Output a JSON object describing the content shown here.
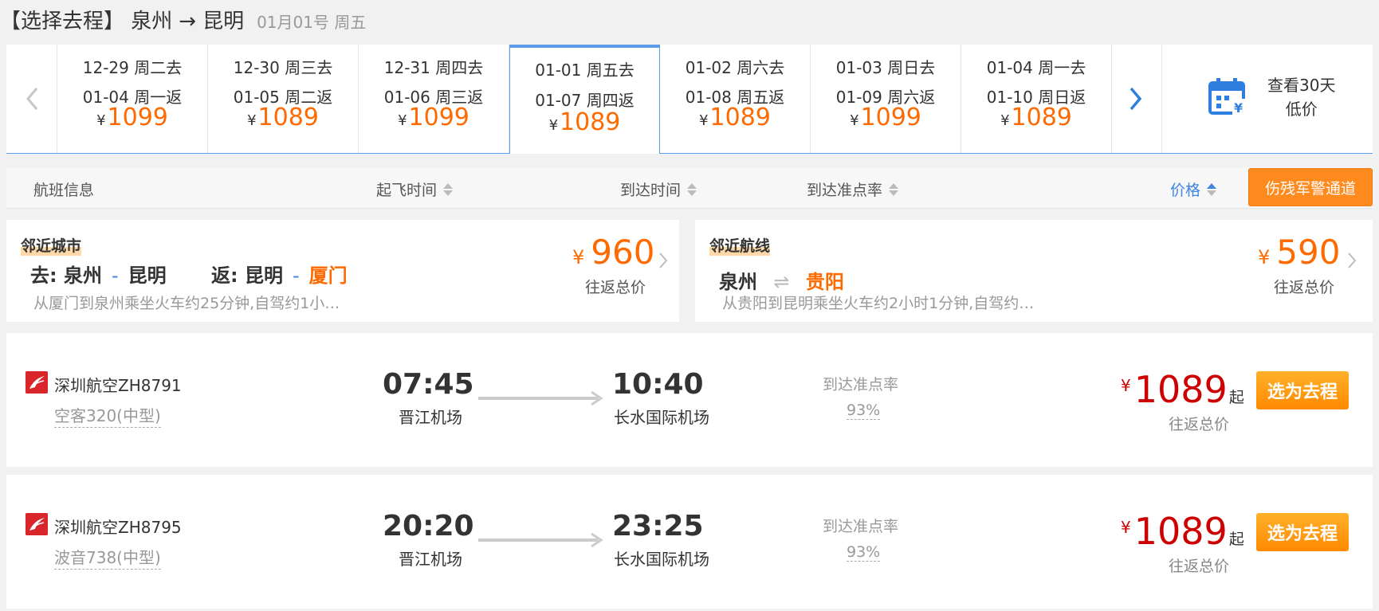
{
  "header": {
    "title": "【选择去程】 泉州",
    "arrow": "→",
    "dest": "昆明",
    "date": "01月01号 周五"
  },
  "date_strip": {
    "currency": "¥",
    "dates": [
      {
        "depart": "12-29 周二去",
        "return": "01-04 周一返",
        "price": "1099",
        "active": false
      },
      {
        "depart": "12-30 周三去",
        "return": "01-05 周二返",
        "price": "1089",
        "active": false
      },
      {
        "depart": "12-31 周四去",
        "return": "01-06 周三返",
        "price": "1099",
        "active": false
      },
      {
        "depart": "01-01 周五去",
        "return": "01-07 周四返",
        "price": "1089",
        "active": true
      },
      {
        "depart": "01-02 周六去",
        "return": "01-08 周五返",
        "price": "1089",
        "active": false
      },
      {
        "depart": "01-03 周日去",
        "return": "01-09 周六返",
        "price": "1099",
        "active": false
      },
      {
        "depart": "01-04 周一去",
        "return": "01-10 周日返",
        "price": "1089",
        "active": false
      }
    ],
    "calendar_line1": "查看30天",
    "calendar_line2": "低价"
  },
  "sort_bar": {
    "flight_info": "航班信息",
    "depart_time": "起飞时间",
    "arrive_time": "到达时间",
    "ontime": "到达准点率",
    "price": "价格",
    "special_channel": "伤残军警通道"
  },
  "nearby": [
    {
      "tag": "邻近城市",
      "go_label": "去:",
      "go_from": "泉州",
      "go_to": "昆明",
      "back_label": "返:",
      "back_from": "昆明",
      "back_to": "厦门",
      "desc": "从厦门到泉州乘坐火车约25分钟,自驾约1小…",
      "currency": "¥",
      "price": "960",
      "price_sub": "往返总价"
    },
    {
      "tag": "邻近航线",
      "from": "泉州",
      "swap": "⇌",
      "to": "贵阳",
      "desc": "从贵阳到昆明乘坐火车约2小时1分钟,自驾约…",
      "currency": "¥",
      "price": "590",
      "price_sub": "往返总价"
    }
  ],
  "flights": [
    {
      "airline": "深圳航空ZH8791",
      "plane": "空客320(中型)",
      "dep_time": "07:45",
      "dep_airport": "晋江机场",
      "arr_time": "10:40",
      "arr_airport": "长水国际机场",
      "ontime_label": "到达准点率",
      "ontime": "93%",
      "currency": "¥",
      "price": "1089",
      "qi": "起",
      "price_sub": "往返总价",
      "select": "选为去程"
    },
    {
      "airline": "深圳航空ZH8795",
      "plane": "波音738(中型)",
      "dep_time": "20:20",
      "dep_airport": "晋江机场",
      "arr_time": "23:25",
      "arr_airport": "长水国际机场",
      "ontime_label": "到达准点率",
      "ontime": "93%",
      "currency": "¥",
      "price": "1089",
      "qi": "起",
      "price_sub": "往返总价",
      "select": "选为去程"
    }
  ],
  "colors": {
    "accent_blue": "#3d86e2",
    "price_orange": "#ff6a00",
    "price_red": "#cc0000",
    "button_orange": "#ff8a1e"
  }
}
